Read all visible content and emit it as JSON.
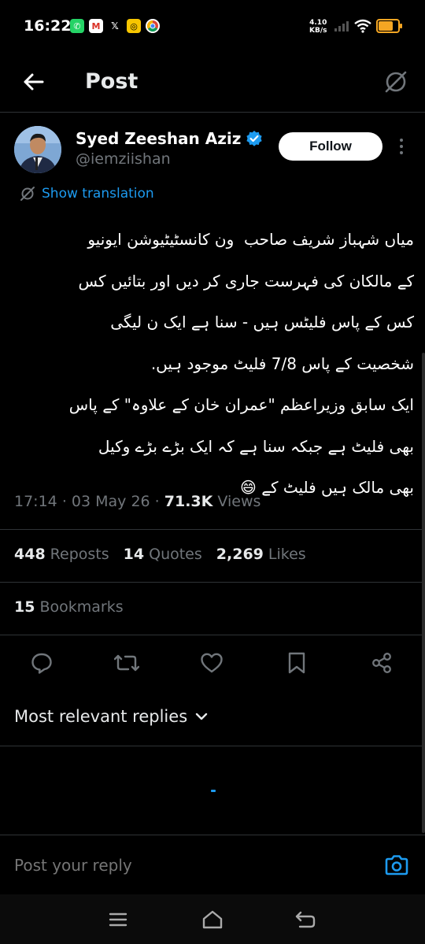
{
  "status_bar": {
    "time": "16:22",
    "speed_value": "4.10",
    "speed_unit": "KB/s",
    "battery_level": 0.75
  },
  "header": {
    "title": "Post"
  },
  "author": {
    "name": "Syed Zeeshan Aziz",
    "handle": "@iemziishan",
    "verified": true,
    "follow_label": "Follow"
  },
  "translate_label": "Show translation",
  "tweet": {
    "text": "میاں شہباز شریف صاحب  ون کانسٹیٹیوشن ایونیو\nکے مالکان کی فہرست جاری کر دیں اور بتائیں کس\nکس کے پاس فلیٹس ہیں - سنا ہے ایک ن لیگی\nشخصیت کے پاس 7/8 فلیٹ موجود ہیں.\nایک سابق وزیراعظم \"عمران خان کے علاوہ\" کے پاس\nبھی فلیٹ ہے جبکہ سنا ہے کہ ایک بڑے بڑے وکیل\nبھی مالک ہیں فلیٹ کے 😄"
  },
  "meta": {
    "time": "17:14",
    "date": "03 May 26",
    "views_count": "71.3K",
    "views_label": "Views"
  },
  "stats": {
    "reposts_count": "448",
    "reposts_label": "Reposts",
    "quotes_count": "14",
    "quotes_label": "Quotes",
    "likes_count": "2,269",
    "likes_label": "Likes",
    "bookmarks_count": "15",
    "bookmarks_label": "Bookmarks"
  },
  "replies_sort": {
    "label": "Most relevant replies"
  },
  "reply_box": {
    "placeholder": "Post your reply"
  },
  "colors": {
    "accent": "#1d9bf0",
    "background": "#000000",
    "muted": "#71767b",
    "battery": "#f5a623"
  }
}
